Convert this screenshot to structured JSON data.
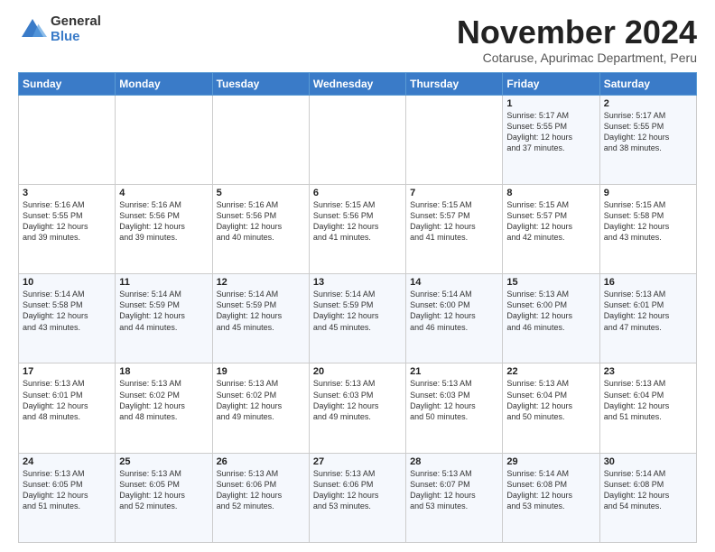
{
  "header": {
    "logo_general": "General",
    "logo_blue": "Blue",
    "month_title": "November 2024",
    "subtitle": "Cotaruse, Apurimac Department, Peru"
  },
  "calendar": {
    "days_of_week": [
      "Sunday",
      "Monday",
      "Tuesday",
      "Wednesday",
      "Thursday",
      "Friday",
      "Saturday"
    ],
    "weeks": [
      [
        {
          "day": "",
          "info": ""
        },
        {
          "day": "",
          "info": ""
        },
        {
          "day": "",
          "info": ""
        },
        {
          "day": "",
          "info": ""
        },
        {
          "day": "",
          "info": ""
        },
        {
          "day": "1",
          "info": "Sunrise: 5:17 AM\nSunset: 5:55 PM\nDaylight: 12 hours\nand 37 minutes."
        },
        {
          "day": "2",
          "info": "Sunrise: 5:17 AM\nSunset: 5:55 PM\nDaylight: 12 hours\nand 38 minutes."
        }
      ],
      [
        {
          "day": "3",
          "info": "Sunrise: 5:16 AM\nSunset: 5:55 PM\nDaylight: 12 hours\nand 39 minutes."
        },
        {
          "day": "4",
          "info": "Sunrise: 5:16 AM\nSunset: 5:56 PM\nDaylight: 12 hours\nand 39 minutes."
        },
        {
          "day": "5",
          "info": "Sunrise: 5:16 AM\nSunset: 5:56 PM\nDaylight: 12 hours\nand 40 minutes."
        },
        {
          "day": "6",
          "info": "Sunrise: 5:15 AM\nSunset: 5:56 PM\nDaylight: 12 hours\nand 41 minutes."
        },
        {
          "day": "7",
          "info": "Sunrise: 5:15 AM\nSunset: 5:57 PM\nDaylight: 12 hours\nand 41 minutes."
        },
        {
          "day": "8",
          "info": "Sunrise: 5:15 AM\nSunset: 5:57 PM\nDaylight: 12 hours\nand 42 minutes."
        },
        {
          "day": "9",
          "info": "Sunrise: 5:15 AM\nSunset: 5:58 PM\nDaylight: 12 hours\nand 43 minutes."
        }
      ],
      [
        {
          "day": "10",
          "info": "Sunrise: 5:14 AM\nSunset: 5:58 PM\nDaylight: 12 hours\nand 43 minutes."
        },
        {
          "day": "11",
          "info": "Sunrise: 5:14 AM\nSunset: 5:59 PM\nDaylight: 12 hours\nand 44 minutes."
        },
        {
          "day": "12",
          "info": "Sunrise: 5:14 AM\nSunset: 5:59 PM\nDaylight: 12 hours\nand 45 minutes."
        },
        {
          "day": "13",
          "info": "Sunrise: 5:14 AM\nSunset: 5:59 PM\nDaylight: 12 hours\nand 45 minutes."
        },
        {
          "day": "14",
          "info": "Sunrise: 5:14 AM\nSunset: 6:00 PM\nDaylight: 12 hours\nand 46 minutes."
        },
        {
          "day": "15",
          "info": "Sunrise: 5:13 AM\nSunset: 6:00 PM\nDaylight: 12 hours\nand 46 minutes."
        },
        {
          "day": "16",
          "info": "Sunrise: 5:13 AM\nSunset: 6:01 PM\nDaylight: 12 hours\nand 47 minutes."
        }
      ],
      [
        {
          "day": "17",
          "info": "Sunrise: 5:13 AM\nSunset: 6:01 PM\nDaylight: 12 hours\nand 48 minutes."
        },
        {
          "day": "18",
          "info": "Sunrise: 5:13 AM\nSunset: 6:02 PM\nDaylight: 12 hours\nand 48 minutes."
        },
        {
          "day": "19",
          "info": "Sunrise: 5:13 AM\nSunset: 6:02 PM\nDaylight: 12 hours\nand 49 minutes."
        },
        {
          "day": "20",
          "info": "Sunrise: 5:13 AM\nSunset: 6:03 PM\nDaylight: 12 hours\nand 49 minutes."
        },
        {
          "day": "21",
          "info": "Sunrise: 5:13 AM\nSunset: 6:03 PM\nDaylight: 12 hours\nand 50 minutes."
        },
        {
          "day": "22",
          "info": "Sunrise: 5:13 AM\nSunset: 6:04 PM\nDaylight: 12 hours\nand 50 minutes."
        },
        {
          "day": "23",
          "info": "Sunrise: 5:13 AM\nSunset: 6:04 PM\nDaylight: 12 hours\nand 51 minutes."
        }
      ],
      [
        {
          "day": "24",
          "info": "Sunrise: 5:13 AM\nSunset: 6:05 PM\nDaylight: 12 hours\nand 51 minutes."
        },
        {
          "day": "25",
          "info": "Sunrise: 5:13 AM\nSunset: 6:05 PM\nDaylight: 12 hours\nand 52 minutes."
        },
        {
          "day": "26",
          "info": "Sunrise: 5:13 AM\nSunset: 6:06 PM\nDaylight: 12 hours\nand 52 minutes."
        },
        {
          "day": "27",
          "info": "Sunrise: 5:13 AM\nSunset: 6:06 PM\nDaylight: 12 hours\nand 53 minutes."
        },
        {
          "day": "28",
          "info": "Sunrise: 5:13 AM\nSunset: 6:07 PM\nDaylight: 12 hours\nand 53 minutes."
        },
        {
          "day": "29",
          "info": "Sunrise: 5:14 AM\nSunset: 6:08 PM\nDaylight: 12 hours\nand 53 minutes."
        },
        {
          "day": "30",
          "info": "Sunrise: 5:14 AM\nSunset: 6:08 PM\nDaylight: 12 hours\nand 54 minutes."
        }
      ]
    ]
  }
}
